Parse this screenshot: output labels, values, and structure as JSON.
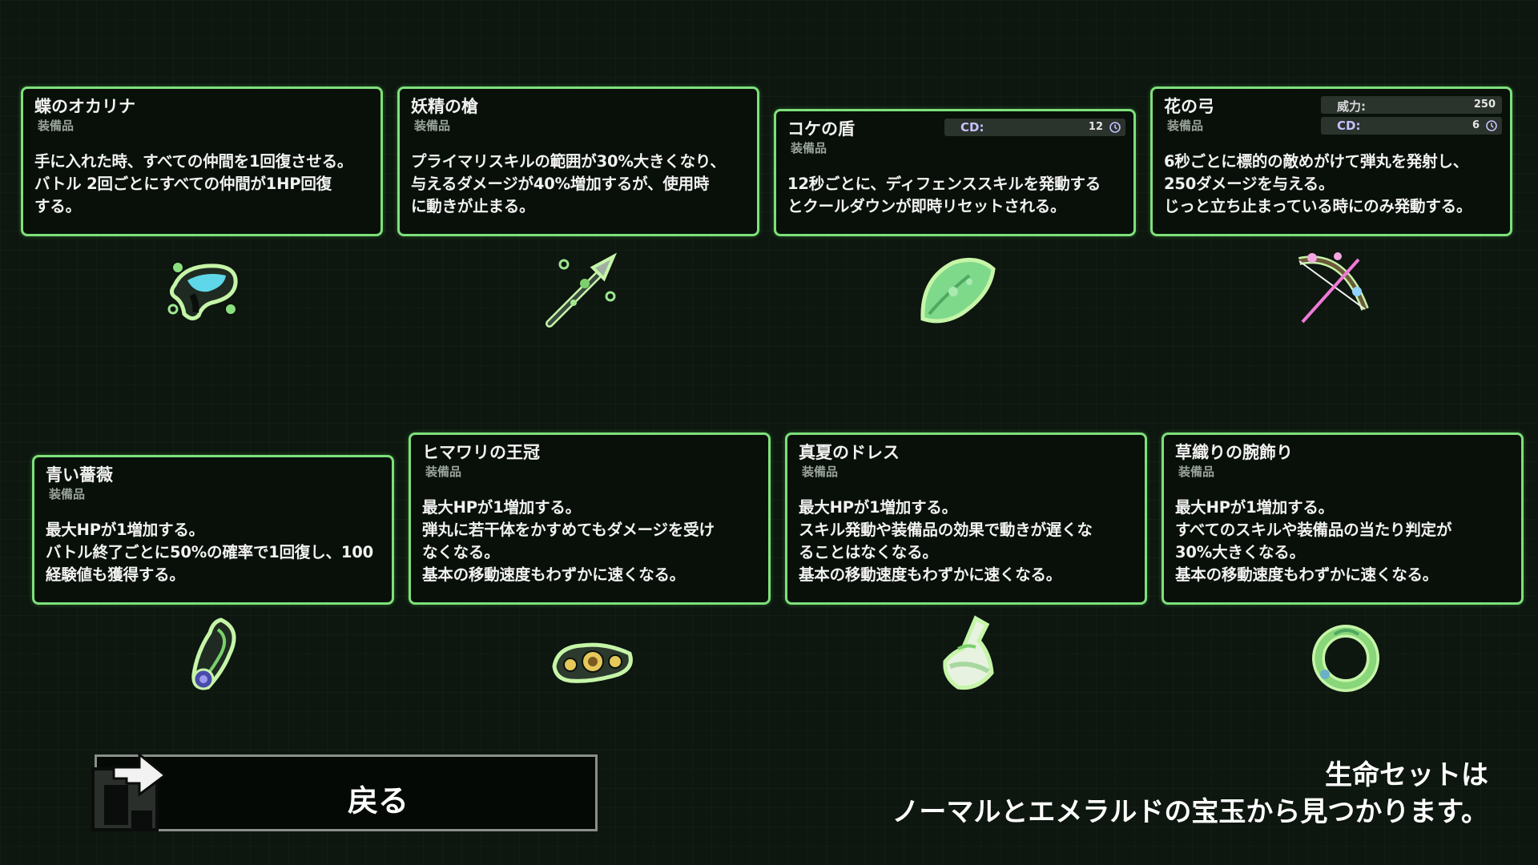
{
  "items": [
    {
      "name": "蝶のオカリナ",
      "type": "装備品",
      "desc": "手に入れた時、すべての仲間を1回復させる。\nバトル 2回ごとにすべての仲間が1HP回復\nする。",
      "icon": "butterfly-ocarina-icon"
    },
    {
      "name": "妖精の槍",
      "type": "装備品",
      "desc": "プライマリスキルの範囲が30%大きくなり、\n与えるダメージが40%増加するが、使用時\nに動きが止まる。",
      "icon": "fairy-spear-icon"
    },
    {
      "name": "コケの盾",
      "type": "装備品",
      "desc": "12秒ごとに、ディフェンススキルを発動する\nとクールダウンが即時リセットされる。",
      "icon": "moss-shield-icon",
      "stats": [
        {
          "label": "CD:",
          "value": "12"
        }
      ]
    },
    {
      "name": "花の弓",
      "type": "装備品",
      "desc": "6秒ごとに標的の敵めがけて弾丸を発射し、\n250ダメージを与える。\nじっと立ち止まっている時にのみ発動する。",
      "icon": "flower-bow-icon",
      "stats": [
        {
          "label": "威力:",
          "value": "250"
        },
        {
          "label": "CD:",
          "value": "6"
        }
      ]
    },
    {
      "name": "青い薔薇",
      "type": "装備品",
      "desc": "最大HPが1増加する。\nバトル終了ごとに50%の確率で1回復し、100\n経験値も獲得する。",
      "icon": "blue-rose-icon"
    },
    {
      "name": "ヒマワリの王冠",
      "type": "装備品",
      "desc": "最大HPが1増加する。\n弾丸に若干体をかすめてもダメージを受け\nなくなる。\n基本の移動速度もわずかに速くなる。",
      "icon": "sunflower-crown-icon"
    },
    {
      "name": "真夏のドレス",
      "type": "装備品",
      "desc": "最大HPが1増加する。\nスキル発動や装備品の効果で動きが遅くな\nることはなくなる。\n基本の移動速度もわずかに速くなる。",
      "icon": "summer-dress-icon"
    },
    {
      "name": "草織りの腕飾り",
      "type": "装備品",
      "desc": "最大HPが1増加する。\nすべてのスキルや装備品の当たり判定が\n30%大きくなる。\n基本の移動速度もわずかに速くなる。",
      "icon": "grass-bracelet-icon"
    }
  ],
  "back_button": {
    "label": "戻る",
    "icon": "back-arrow-icon"
  },
  "footer": {
    "line1": "生命セットは",
    "line2": "ノーマルとエメラルドの宝玉から見つかります。"
  },
  "colors": {
    "border": "#7ee07a",
    "background": "#0d160f",
    "stat_label": "#c8c0ff"
  }
}
